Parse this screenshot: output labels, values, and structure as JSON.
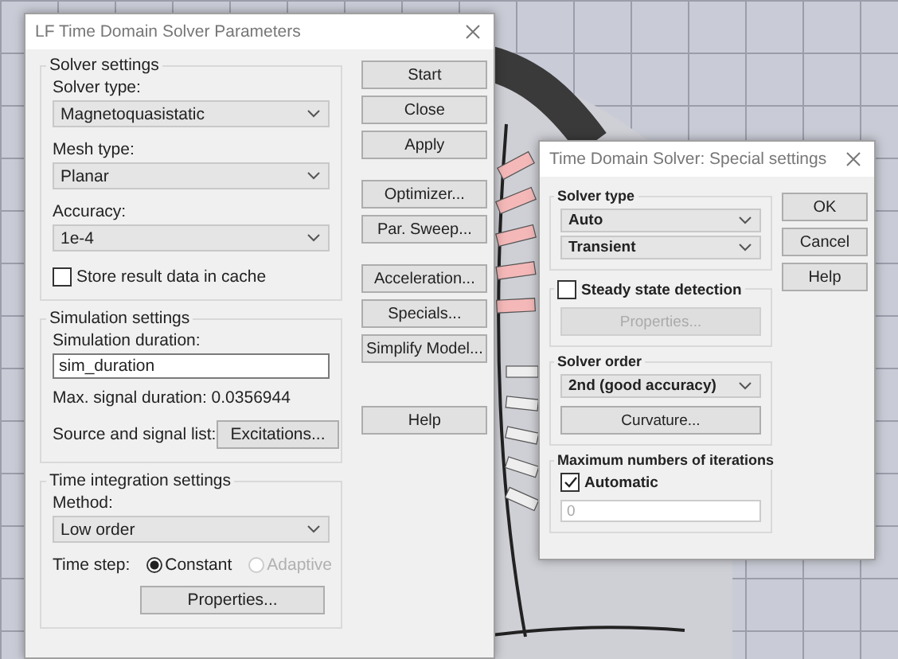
{
  "main_dialog": {
    "title": "LF Time Domain Solver Parameters",
    "groups": [
      {
        "header": {
          "kind": "title",
          "text": "Solver settings"
        },
        "items": [
          {
            "kind": "label",
            "text": "Solver type:"
          },
          {
            "kind": "dropdown",
            "value": "Magnetoquasistatic"
          },
          {
            "kind": "label",
            "text": "Mesh type:"
          },
          {
            "kind": "dropdown",
            "value": "Planar"
          },
          {
            "kind": "label",
            "text": "Accuracy:"
          },
          {
            "kind": "dropdown",
            "value": "1e-4"
          },
          {
            "kind": "checkbox",
            "label": "Store result data in cache",
            "checked": false
          }
        ]
      },
      {
        "header": {
          "kind": "title",
          "text": "Simulation settings"
        },
        "items": [
          {
            "kind": "label",
            "text": "Simulation duration:"
          },
          {
            "kind": "field",
            "value": "sim_duration",
            "disabled": false
          },
          {
            "kind": "text",
            "text": "Max. signal duration: 0.0356944"
          },
          {
            "kind": "label_button",
            "label": "Source and signal list:",
            "button": "Excitations..."
          }
        ]
      },
      {
        "header": {
          "kind": "title",
          "text": "Time integration settings"
        },
        "items": [
          {
            "kind": "label",
            "text": "Method:"
          },
          {
            "kind": "dropdown",
            "value": "Low order"
          },
          {
            "kind": "radios",
            "label": "Time step:",
            "options": [
              {
                "label": "Constant",
                "selected": true,
                "disabled": false
              },
              {
                "label": "Adaptive",
                "selected": false,
                "disabled": true
              }
            ]
          },
          {
            "kind": "button",
            "label": "Properties...",
            "disabled": false
          }
        ]
      }
    ],
    "button_groups": [
      [
        "Start",
        "Close",
        "Apply"
      ],
      [
        "Optimizer...",
        "Par. Sweep..."
      ],
      [
        "Acceleration...",
        "Specials...",
        "Simplify Model..."
      ],
      [
        "Help"
      ]
    ]
  },
  "special_dialog": {
    "title": "Time Domain Solver: Special settings",
    "groups": [
      {
        "header": {
          "kind": "title",
          "text": "Solver type"
        },
        "items": [
          {
            "kind": "dropdown",
            "value": "Auto"
          },
          {
            "kind": "dropdown",
            "value": "Transient"
          }
        ]
      },
      {
        "header": {
          "kind": "checkbox",
          "label": "Steady state detection",
          "checked": false
        },
        "items": [
          {
            "kind": "button",
            "label": "Properties...",
            "disabled": true
          }
        ]
      },
      {
        "header": {
          "kind": "title",
          "text": "Solver order"
        },
        "items": [
          {
            "kind": "dropdown",
            "value": "2nd (good accuracy)"
          },
          {
            "kind": "button",
            "label": "Curvature...",
            "disabled": false
          }
        ]
      },
      {
        "header": {
          "kind": "title",
          "text": "Maximum numbers of iterations"
        },
        "items": [
          {
            "kind": "checkbox",
            "label": "Automatic",
            "checked": true
          },
          {
            "kind": "field",
            "value": "0",
            "disabled": true
          }
        ]
      }
    ],
    "button_groups": [
      [
        "OK",
        "Cancel",
        "Help"
      ]
    ]
  }
}
